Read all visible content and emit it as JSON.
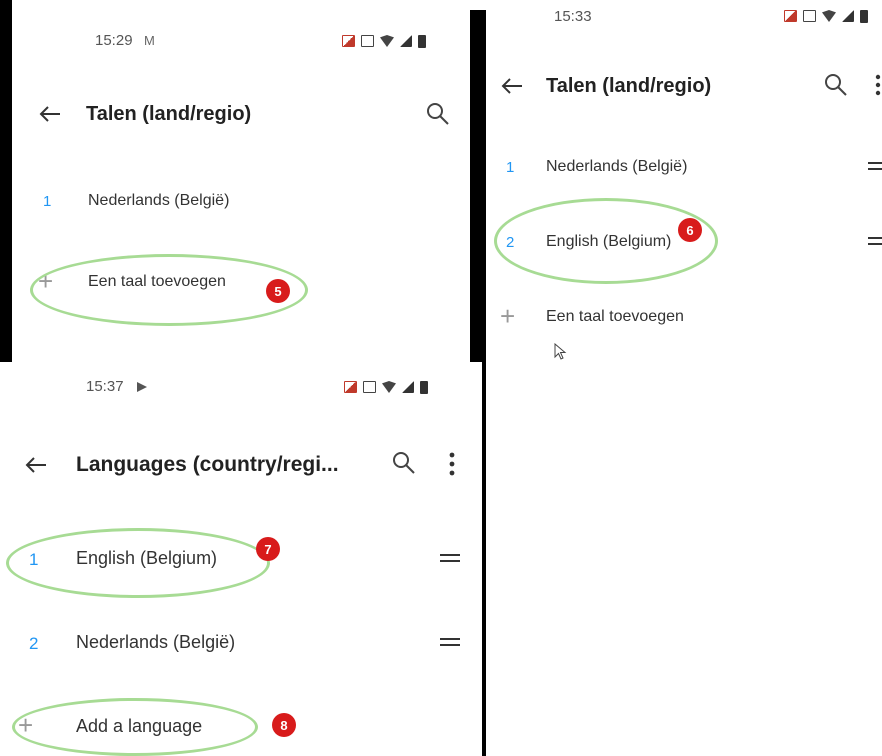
{
  "panel_nl_1": {
    "status_time": "15:29",
    "title": "Talen (land/regio)",
    "items": [
      {
        "num": "1",
        "label": "Nederlands (België)"
      }
    ],
    "add_label": "Een taal toevoegen",
    "badge": "5"
  },
  "panel_nl_2": {
    "status_time": "15:33",
    "title": "Talen (land/regio)",
    "items": [
      {
        "num": "1",
        "label": "Nederlands (België)"
      },
      {
        "num": "2",
        "label": "English (Belgium)"
      }
    ],
    "add_label": "Een taal toevoegen",
    "badge": "6"
  },
  "panel_en": {
    "status_time": "15:37",
    "title": "Languages (country/regi...",
    "items": [
      {
        "num": "1",
        "label": "English (Belgium)"
      },
      {
        "num": "2",
        "label": "Nederlands (België)"
      }
    ],
    "add_label": "Add a language",
    "badges": [
      "7",
      "8"
    ]
  },
  "icons": {
    "back": "back-arrow-icon",
    "search": "search-icon",
    "more": "more-vert-icon",
    "drag": "drag-handle-icon",
    "add": "plus-icon",
    "cursor": "mouse-cursor-icon"
  },
  "colors": {
    "accent": "#2196f3",
    "highlight": "#a7db94",
    "badge": "#d81b1b"
  }
}
